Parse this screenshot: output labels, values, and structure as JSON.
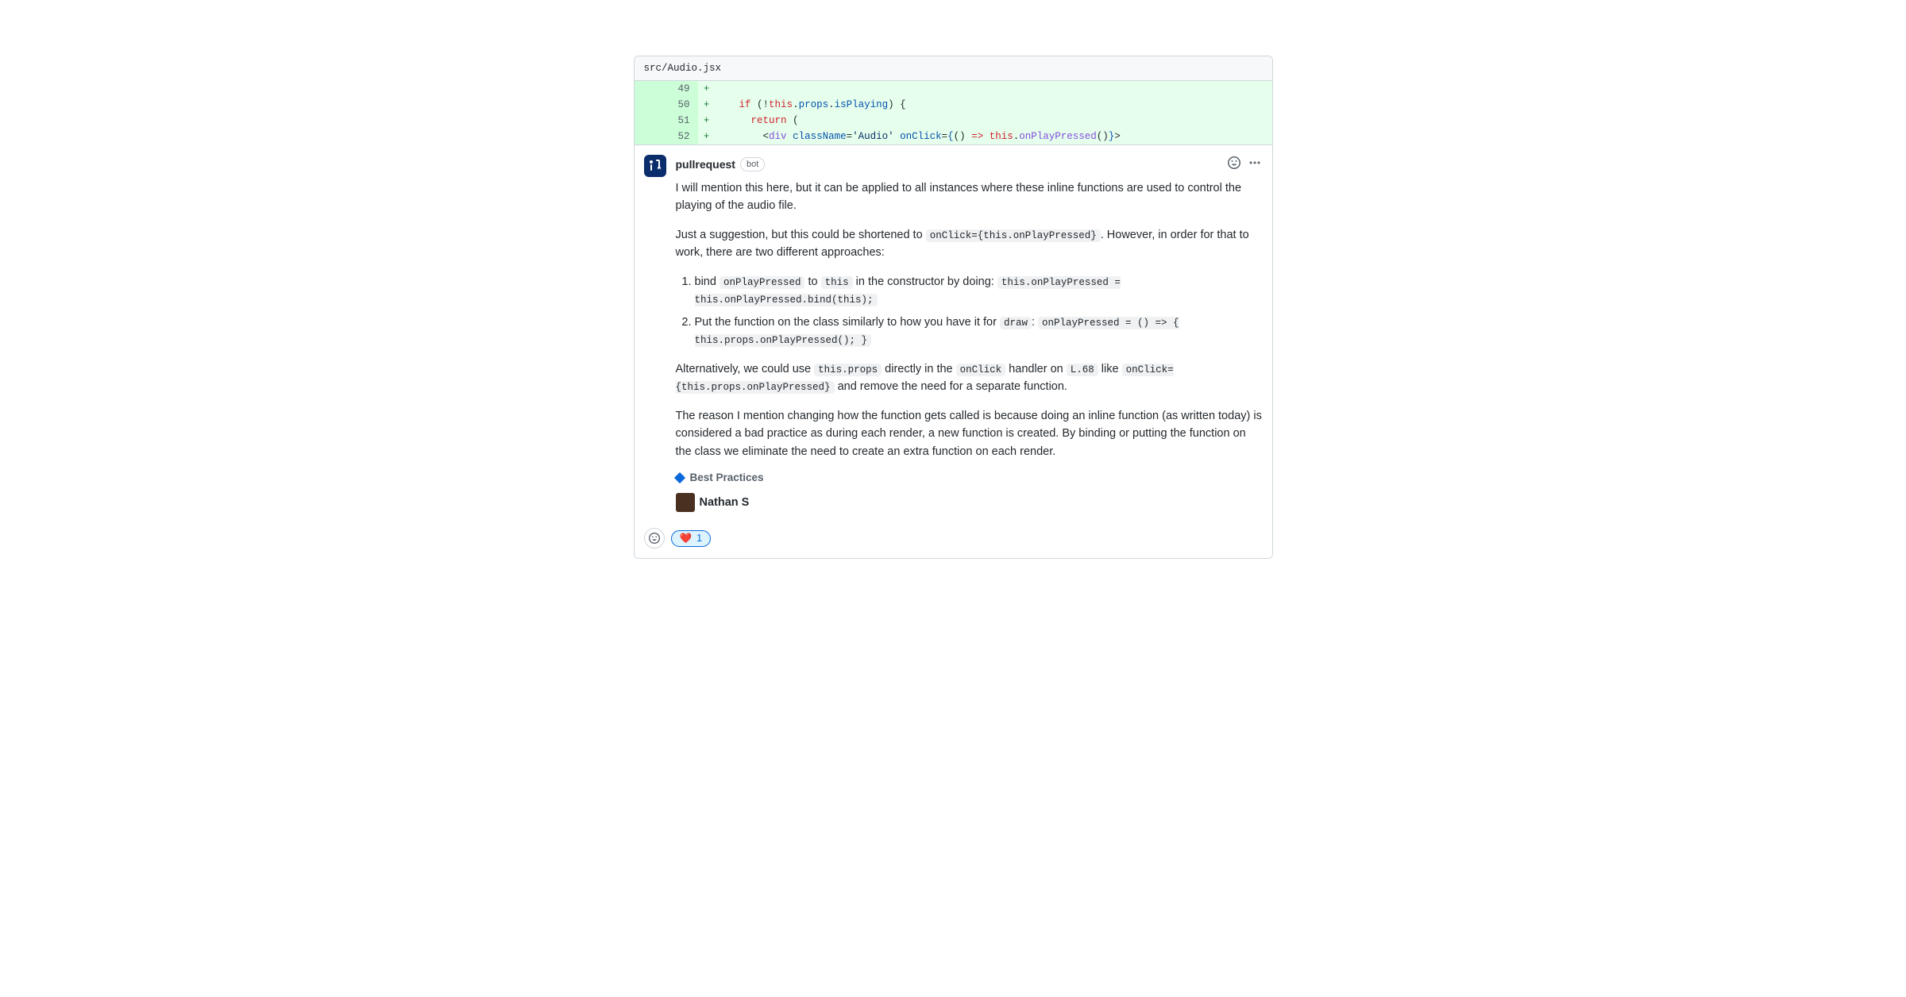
{
  "file": {
    "path": "src/Audio.jsx"
  },
  "diff": {
    "lines": [
      {
        "num": "49",
        "sign": "+",
        "indent": "    ",
        "tokens": []
      },
      {
        "num": "50",
        "sign": "+",
        "indent": "    ",
        "tokens": [
          {
            "t": "kw",
            "v": "if"
          },
          {
            "t": "",
            "v": " (!"
          },
          {
            "t": "kw",
            "v": "this"
          },
          {
            "t": "",
            "v": "."
          },
          {
            "t": "prop",
            "v": "props"
          },
          {
            "t": "",
            "v": "."
          },
          {
            "t": "prop",
            "v": "isPlaying"
          },
          {
            "t": "",
            "v": ") {"
          }
        ]
      },
      {
        "num": "51",
        "sign": "+",
        "indent": "      ",
        "tokens": [
          {
            "t": "kw",
            "v": "return"
          },
          {
            "t": "",
            "v": " ("
          }
        ]
      },
      {
        "num": "52",
        "sign": "+",
        "indent": "        ",
        "tokens": [
          {
            "t": "",
            "v": "<"
          },
          {
            "t": "call",
            "v": "div"
          },
          {
            "t": "",
            "v": " "
          },
          {
            "t": "prop",
            "v": "className"
          },
          {
            "t": "",
            "v": "="
          },
          {
            "t": "str",
            "v": "'Audio'"
          },
          {
            "t": "",
            "v": " "
          },
          {
            "t": "prop",
            "v": "onClick"
          },
          {
            "t": "",
            "v": "="
          },
          {
            "t": "prop",
            "v": "{"
          },
          {
            "t": "",
            "v": "() "
          },
          {
            "t": "kw",
            "v": "=>"
          },
          {
            "t": "",
            "v": " "
          },
          {
            "t": "kw",
            "v": "this"
          },
          {
            "t": "",
            "v": "."
          },
          {
            "t": "call",
            "v": "onPlayPressed"
          },
          {
            "t": "",
            "v": "()"
          },
          {
            "t": "prop",
            "v": "}"
          },
          {
            "t": "",
            "v": ">"
          }
        ]
      }
    ]
  },
  "comment": {
    "author": "pullrequest",
    "bot_label": "bot",
    "p1": "I will mention this here, but it can be applied to all instances where these inline functions are used to control the playing of the audio file.",
    "p2a": "Just a suggestion, but this could be shortened to ",
    "p2_code": "onClick={this.onPlayPressed}",
    "p2b": ". However, in order for that to work, there are two different approaches:",
    "li1a": "bind ",
    "li1_code1": "onPlayPressed",
    "li1b": " to ",
    "li1_code2": "this",
    "li1c": " in the constructor by doing: ",
    "li1_code3": "this.onPlayPressed = this.onPlayPressed.bind(this);",
    "li2a": "Put the function on the class similarly to how you have it for ",
    "li2_code1": "draw",
    "li2b": ": ",
    "li2_code2": "onPlayPressed = () => { this.props.onPlayPressed(); }",
    "p3a": "Alternatively, we could use ",
    "p3_code1": "this.props",
    "p3b": " directly in the ",
    "p3_code2": "onClick",
    "p3c": " handler on ",
    "p3_code3": "L.68",
    "p3d": " like ",
    "p3_code4": "onClick={this.props.onPlayPressed}",
    "p3e": " and remove the need for a separate function.",
    "p4": "The reason I mention changing how the function gets called is because doing an inline function (as written today) is considered a bad practice as during each render, a new function is created. By binding or putting the function on the class we eliminate the need to create an extra function on each render.",
    "tag": "Best Practices",
    "signoff_name": "Nathan S"
  },
  "reactions": {
    "heart_emoji": "❤️",
    "heart_count": "1"
  }
}
